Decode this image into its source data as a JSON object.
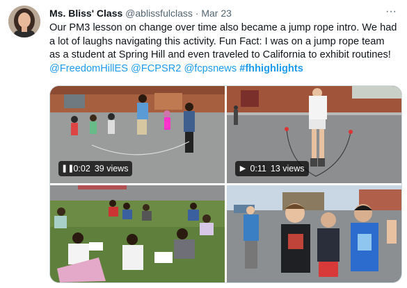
{
  "tweet": {
    "display_name": "Ms. Bliss' Class",
    "handle": "@ablissfulclass",
    "separator": "·",
    "date": "Mar 23",
    "more_symbol": "···",
    "text_part1": "Our PM3 lesson on change over time also became a jump rope intro. We had a lot of laughs navigating this activity. Fun Fact: I was on a jump rope team as a student at Spring Hill and even traveled to California to exhibit routines! ",
    "mention1": "@FreedomHillES",
    "mention2": "@FCPSR2",
    "mention3": "@fcpsnews",
    "hashtag": "#fhhighlights"
  },
  "media": {
    "video1": {
      "play_symbol": "❚❚",
      "time": "0:02",
      "views": "39 views"
    },
    "video2": {
      "play_symbol": "▶",
      "time": "0:11",
      "views": "13 views"
    }
  },
  "colors": {
    "link": "#1d9bf0",
    "text": "#0f1419",
    "secondary": "#536471"
  }
}
